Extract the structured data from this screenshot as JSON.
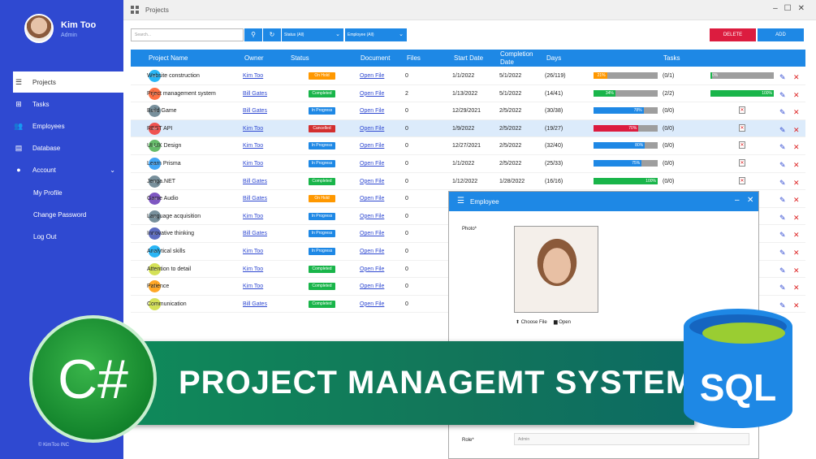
{
  "user": {
    "name": "Kim Too",
    "role": "Admin"
  },
  "nav": [
    {
      "label": "Projects",
      "icon": "list-icon"
    },
    {
      "label": "Tasks",
      "icon": "tasks-icon"
    },
    {
      "label": "Employees",
      "icon": "users-icon"
    },
    {
      "label": "Database",
      "icon": "database-icon"
    },
    {
      "label": "Account",
      "icon": "user-icon"
    }
  ],
  "account_menu": [
    "My Profile",
    "Change Password",
    "Log Out"
  ],
  "copyright": "© KimToo INC",
  "window": {
    "title": "Projects"
  },
  "toolbar": {
    "search_placeholder": "Search...",
    "status_filter": "Status (All)",
    "employee_filter": "Employee (All)",
    "delete_label": "DELETE",
    "add_label": "ADD"
  },
  "columns": [
    "Project Name",
    "Owner",
    "Status",
    "Document",
    "Files",
    "Start Date",
    "Completion Date",
    "Days",
    "Tasks"
  ],
  "rows": [
    {
      "init": "WC",
      "color": "#29b6f6",
      "name": "Website construction",
      "owner": "Kim Too",
      "status": "On Hold",
      "scolor": "#ff9800",
      "doc": "Open File",
      "files": "0",
      "start": "1/1/2022",
      "end": "5/1/2022",
      "days": "(26/119)",
      "pct": 21,
      "pcolor": "#ff9800",
      "tasks": "(0/1)",
      "t2": "0%",
      "t2pct": 0
    },
    {
      "init": "PE",
      "color": "#ff7043",
      "name": "Prject management system",
      "owner": "Bill Gates",
      "status": "Completed",
      "scolor": "#19b54a",
      "doc": "Open File",
      "files": "2",
      "start": "1/13/2022",
      "end": "5/1/2022",
      "days": "(14/41)",
      "pct": 34,
      "pcolor": "#19b54a",
      "tasks": "(2/2)",
      "t2": "100%",
      "t2pct": 100
    },
    {
      "init": "BG",
      "color": "#78909c",
      "name": "Build Game",
      "owner": "Bill Gates",
      "status": "In Progress",
      "scolor": "#1e88e5",
      "doc": "Open File",
      "files": "0",
      "start": "12/29/2021",
      "end": "2/5/2022",
      "days": "(30/38)",
      "pct": 78,
      "pcolor": "#1e88e5",
      "tasks": "(0/0)"
    },
    {
      "init": "RA",
      "color": "#ef5350",
      "name": "REST API",
      "owner": "Kim Too",
      "status": "Cancelled",
      "scolor": "#d32f2f",
      "doc": "Open File",
      "files": "0",
      "start": "1/9/2022",
      "end": "2/5/2022",
      "days": "(19/27)",
      "pct": 70,
      "pcolor": "#dc1c3f",
      "tasks": "(0/0)"
    },
    {
      "init": "UI",
      "color": "#66bb6a",
      "name": "UI UX Design",
      "owner": "Kim Too",
      "status": "In Progress",
      "scolor": "#1e88e5",
      "doc": "Open File",
      "files": "0",
      "start": "12/27/2021",
      "end": "2/5/2022",
      "days": "(32/40)",
      "pct": 80,
      "pcolor": "#1e88e5",
      "tasks": "(0/0)"
    },
    {
      "init": "LP",
      "color": "#42a5f5",
      "name": "Learn Prisma",
      "owner": "Kim Too",
      "status": "In Progress",
      "scolor": "#1e88e5",
      "doc": "Open File",
      "files": "0",
      "start": "1/1/2022",
      "end": "2/5/2022",
      "days": "(25/33)",
      "pct": 75,
      "pcolor": "#1e88e5",
      "tasks": "(0/0)"
    },
    {
      "init": "JE",
      "color": "#78909c",
      "name": "Jenga.NET",
      "owner": "Bill Gates",
      "status": "Completed",
      "scolor": "#19b54a",
      "doc": "Open File",
      "files": "0",
      "start": "1/12/2022",
      "end": "1/28/2022",
      "days": "(16/16)",
      "pct": 100,
      "pcolor": "#19b54a",
      "tasks": "(0/0)"
    },
    {
      "init": "GA",
      "color": "#7e57c2",
      "name": "Game Audio",
      "owner": "Bill Gates",
      "status": "On Hold",
      "scolor": "#ff9800",
      "doc": "Open File",
      "files": "0"
    },
    {
      "init": "LA",
      "color": "#78909c",
      "name": "Language acquisition",
      "owner": "Kim Too",
      "status": "In Progress",
      "scolor": "#1e88e5",
      "doc": "Open File",
      "files": "0"
    },
    {
      "init": "IT",
      "color": "#5c6bc0",
      "name": "Innovative thinking",
      "owner": "Bill Gates",
      "status": "In Progress",
      "scolor": "#1e88e5",
      "doc": "Open File",
      "files": "0"
    },
    {
      "init": "AS",
      "color": "#29b6f6",
      "name": "Analytical skills",
      "owner": "Kim Too",
      "status": "In Progress",
      "scolor": "#1e88e5",
      "doc": "Open File",
      "files": "0"
    },
    {
      "init": "AT",
      "color": "#d4e157",
      "name": "Attention to detail",
      "owner": "Kim Too",
      "status": "Completed",
      "scolor": "#19b54a",
      "doc": "Open File",
      "files": "0"
    },
    {
      "init": "PA",
      "color": "#ffa726",
      "name": "Patience",
      "owner": "Kim Too",
      "status": "Completed",
      "scolor": "#19b54a",
      "doc": "Open File",
      "files": "0"
    },
    {
      "init": "CO",
      "color": "#d4e157",
      "name": "Communication",
      "owner": "Bill Gates",
      "status": "Completed",
      "scolor": "#19b54a",
      "doc": "Open File",
      "files": "0"
    }
  ],
  "dialog": {
    "title": "Employee",
    "photo_label": "Photo*",
    "choose_file": "Choose File",
    "open": "Open",
    "role_label": "Role*",
    "role_value": "Admin"
  },
  "banner": {
    "title": "PROJECT MANAGEMT SYSTEM",
    "csharp": "C#",
    "sql": "SQL"
  }
}
